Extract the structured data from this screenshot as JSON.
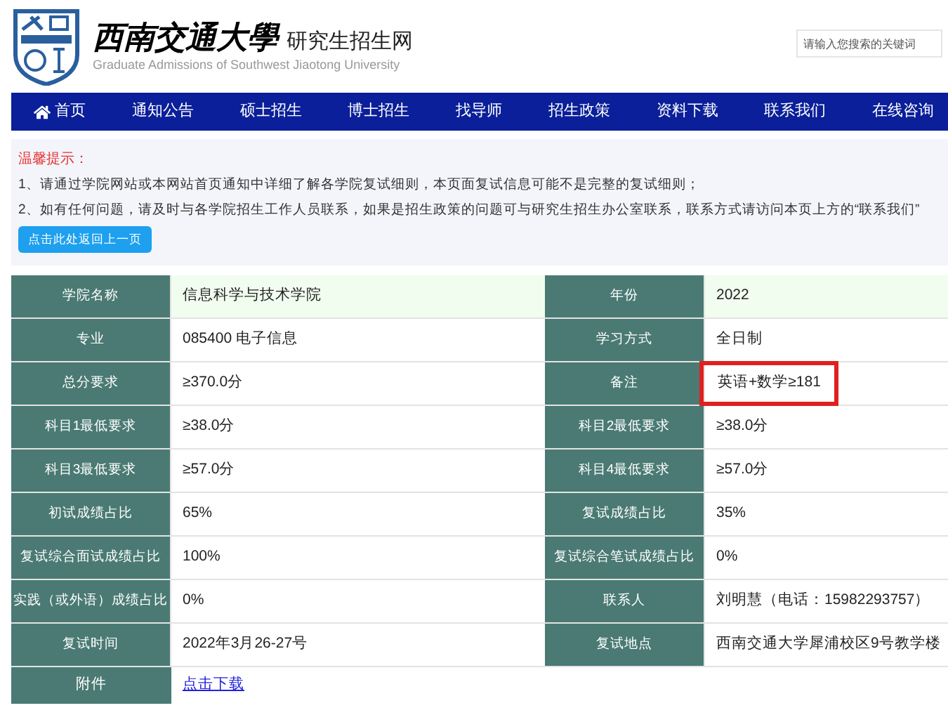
{
  "header": {
    "university_name": "西南交通大學",
    "site_name": "研究生招生网",
    "subtitle": "Graduate Admissions of Southwest Jiaotong University",
    "search": {
      "placeholder": "请输入您搜索的关键词"
    }
  },
  "nav": [
    {
      "label": "首页",
      "kind": "home"
    },
    {
      "label": "通知公告",
      "kind": "link"
    },
    {
      "label": "硕士招生",
      "kind": "link"
    },
    {
      "label": "博士招生",
      "kind": "link"
    },
    {
      "label": "找导师",
      "kind": "link"
    },
    {
      "label": "招生政策",
      "kind": "link"
    },
    {
      "label": "资料下载",
      "kind": "link"
    },
    {
      "label": "联系我们",
      "kind": "link"
    },
    {
      "label": "在线咨询",
      "kind": "link"
    }
  ],
  "notice": {
    "title": "温馨提示：",
    "lines": [
      "1、请通过学院网站或本网站首页通知中详细了解各学院复试细则，本页面复试信息可能不是完整的复试细则；",
      "2、如有任何问题，请及时与各学院招生工作人员联系，如果是招生政策的问题可与研究生招生办公室联系，联系方式请访问本页上方的“联系我们”"
    ],
    "back_button": "点击此处返回上一页"
  },
  "table": {
    "rows": [
      {
        "cells": [
          {
            "label": "学院名称",
            "value": "信息科学与技术学院",
            "highlighted": false
          },
          {
            "label": "年份",
            "value": "2022",
            "highlighted": false
          }
        ]
      },
      {
        "cells": [
          {
            "label": "专业",
            "value": "085400 电子信息",
            "highlighted": false
          },
          {
            "label": "学习方式",
            "value": "全日制",
            "highlighted": false
          }
        ]
      },
      {
        "cells": [
          {
            "label": "总分要求",
            "value": "≥370.0分",
            "highlighted": false
          },
          {
            "label": "备注",
            "value": "英语+数学≥181",
            "highlighted": true
          }
        ]
      },
      {
        "cells": [
          {
            "label": "科目1最低要求",
            "value": "≥38.0分",
            "highlighted": false
          },
          {
            "label": "科目2最低要求",
            "value": "≥38.0分",
            "highlighted": false
          }
        ]
      },
      {
        "cells": [
          {
            "label": "科目3最低要求",
            "value": "≥57.0分",
            "highlighted": false
          },
          {
            "label": "科目4最低要求",
            "value": "≥57.0分",
            "highlighted": false
          }
        ]
      },
      {
        "cells": [
          {
            "label": "初试成绩占比",
            "value": "65%",
            "highlighted": false
          },
          {
            "label": "复试成绩占比",
            "value": "35%",
            "highlighted": false
          }
        ]
      },
      {
        "cells": [
          {
            "label": "复试综合面试成绩占比",
            "value": "100%",
            "highlighted": false
          },
          {
            "label": "复试综合笔试成绩占比",
            "value": "0%",
            "highlighted": false
          }
        ]
      },
      {
        "cells": [
          {
            "label": "实践（或外语）成绩占比",
            "value": "0%",
            "highlighted": false
          },
          {
            "label": "联系人",
            "value": "刘明慧（电话：15982293757）",
            "highlighted": false
          }
        ]
      },
      {
        "cells": [
          {
            "label": "复试时间",
            "value": "2022年3月26-27号",
            "highlighted": false
          },
          {
            "label": "复试地点",
            "value": "西南交通大学犀浦校区9号教学楼",
            "highlighted": false
          }
        ]
      }
    ],
    "attachment": {
      "label": "附件",
      "link": "点击下载"
    }
  }
}
